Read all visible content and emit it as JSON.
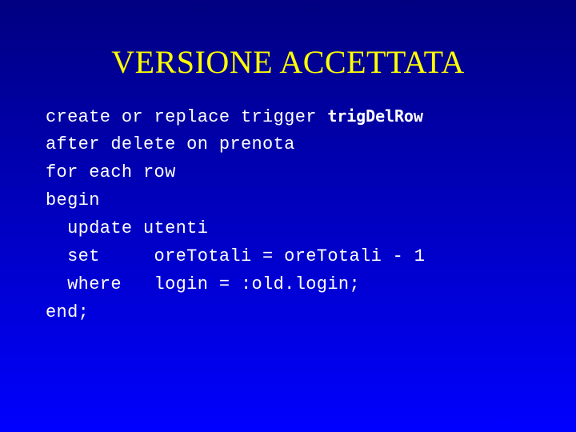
{
  "slide": {
    "title": "VERSIONE ACCETTATA",
    "background": {
      "gradient_from": "#000080",
      "gradient_to": "#0000FF",
      "direction": "top-to-bottom"
    },
    "title_color": "#FFFF00",
    "code_color": "#FFFFFF"
  },
  "code": {
    "language": "sql",
    "lines": [
      {
        "indent": "",
        "text": "create or replace trigger ",
        "emphasis": "trigDelRow"
      },
      {
        "indent": "",
        "text": "after delete on prenota",
        "emphasis": ""
      },
      {
        "indent": "",
        "text": "for each row",
        "emphasis": ""
      },
      {
        "indent": "",
        "text": "begin",
        "emphasis": ""
      },
      {
        "indent": "  ",
        "text": "update utenti",
        "emphasis": ""
      },
      {
        "indent": "  ",
        "text": "set     oreTotali = oreTotali - 1",
        "emphasis": ""
      },
      {
        "indent": "  ",
        "text": "where   login = :old.login;",
        "emphasis": ""
      },
      {
        "indent": "",
        "text": "end;",
        "emphasis": ""
      }
    ],
    "full_text": "create or replace trigger trigDelRow\nafter delete on prenota\nfor each row\nbegin\n  update utenti\n  set     oreTotali = oreTotali - 1\n  where   login = :old.login;\nend;"
  }
}
